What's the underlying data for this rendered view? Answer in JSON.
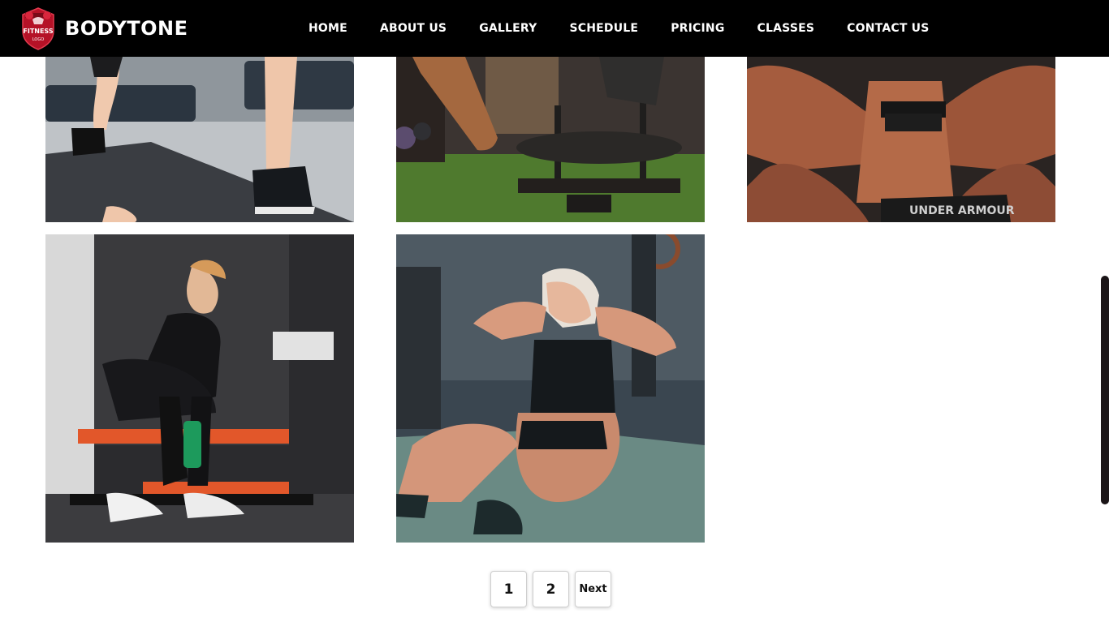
{
  "brand": {
    "name": "BODYTONE",
    "logo_text": "FITNESS",
    "logo_sub": "LOGO"
  },
  "nav": {
    "items": [
      {
        "label": "HOME"
      },
      {
        "label": "ABOUT US"
      },
      {
        "label": "GALLERY"
      },
      {
        "label": "SCHEDULE"
      },
      {
        "label": "PRICING"
      },
      {
        "label": "CLASSES"
      },
      {
        "label": "CONTACT US"
      }
    ]
  },
  "gallery": {
    "photos": [
      {
        "subject": "lunge-on-mat"
      },
      {
        "subject": "sled-on-turf"
      },
      {
        "subject": "back-workout"
      },
      {
        "subject": "man-on-bench"
      },
      {
        "subject": "woman-situp"
      }
    ]
  },
  "pagination": {
    "pages": [
      "1",
      "2"
    ],
    "next_label": "Next"
  },
  "colors": {
    "header_bg": "#000000",
    "logo_red": "#c8102e",
    "page_bg": "#ffffff"
  }
}
